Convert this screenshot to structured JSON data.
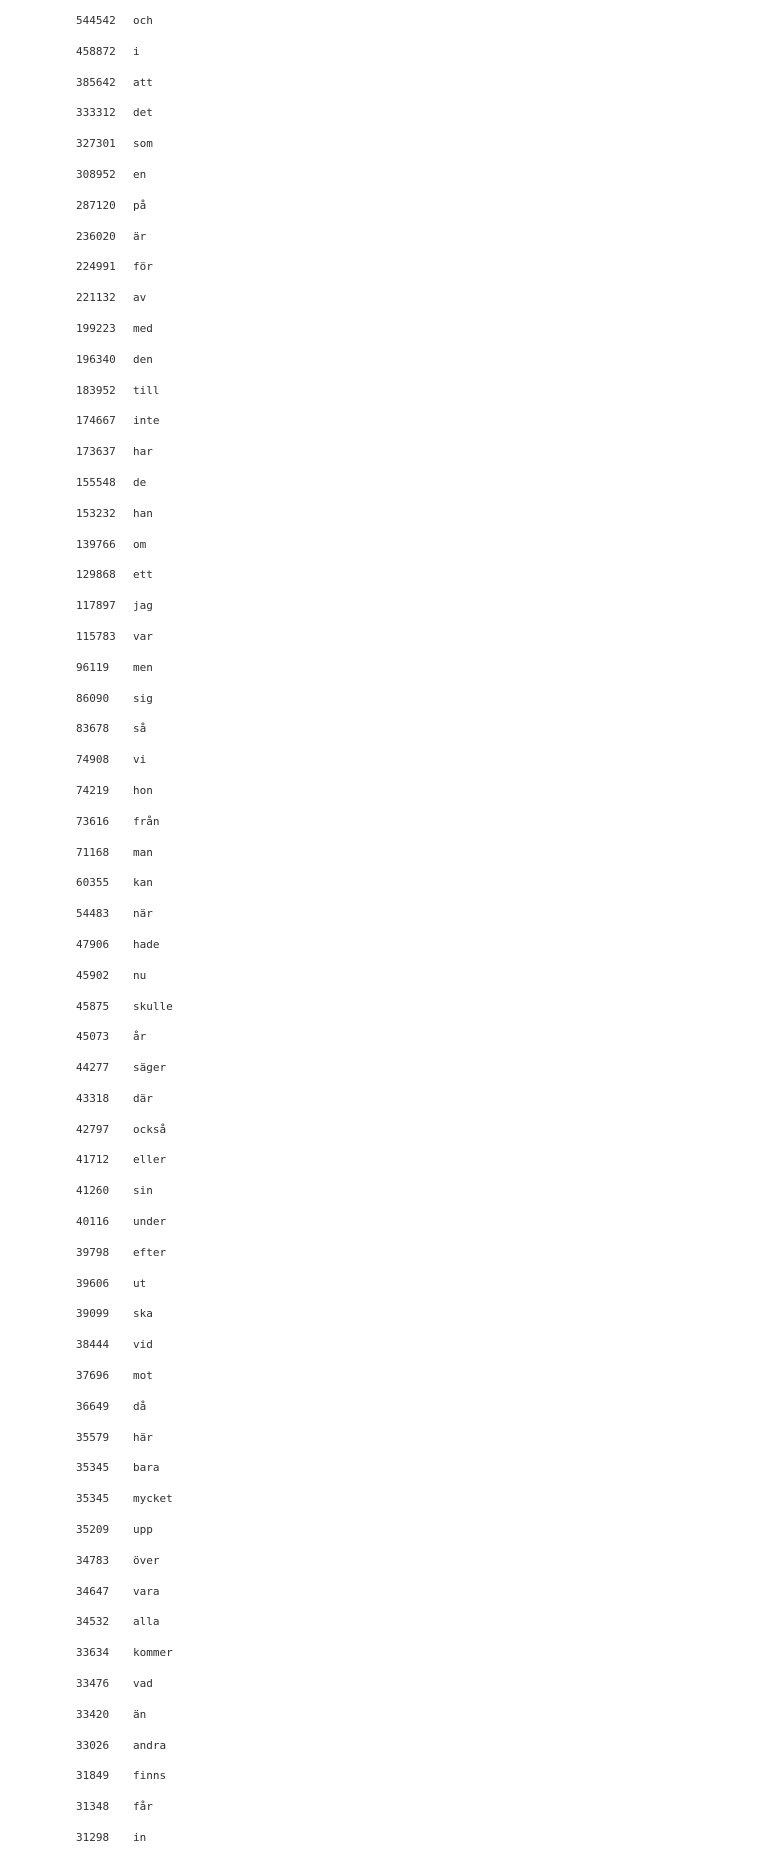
{
  "document": {
    "kind": "plain-text-word-frequency-listing",
    "language": "Swedish",
    "background_color": "#ffffff",
    "text_color": "#2f2f2f",
    "columns": [
      "count",
      "word"
    ],
    "row_count": 60,
    "rows": [
      {
        "count": "544542",
        "word": "och"
      },
      {
        "count": "458872",
        "word": "i"
      },
      {
        "count": "385642",
        "word": "att"
      },
      {
        "count": "333312",
        "word": "det"
      },
      {
        "count": "327301",
        "word": "som"
      },
      {
        "count": "308952",
        "word": "en"
      },
      {
        "count": "287120",
        "word": "på"
      },
      {
        "count": "236020",
        "word": "är"
      },
      {
        "count": "224991",
        "word": "för"
      },
      {
        "count": "221132",
        "word": "av"
      },
      {
        "count": "199223",
        "word": "med"
      },
      {
        "count": "196340",
        "word": "den"
      },
      {
        "count": "183952",
        "word": "till"
      },
      {
        "count": "174667",
        "word": "inte"
      },
      {
        "count": "173637",
        "word": "har"
      },
      {
        "count": "155548",
        "word": "de"
      },
      {
        "count": "153232",
        "word": "han"
      },
      {
        "count": "139766",
        "word": "om"
      },
      {
        "count": "129868",
        "word": "ett"
      },
      {
        "count": "117897",
        "word": "jag"
      },
      {
        "count": "115783",
        "word": "var"
      },
      {
        "count": "96119",
        "word": "men"
      },
      {
        "count": "86090",
        "word": "sig"
      },
      {
        "count": "83678",
        "word": "så"
      },
      {
        "count": "74908",
        "word": "vi"
      },
      {
        "count": "74219",
        "word": "hon"
      },
      {
        "count": "73616",
        "word": "från"
      },
      {
        "count": "71168",
        "word": "man"
      },
      {
        "count": "60355",
        "word": "kan"
      },
      {
        "count": "54483",
        "word": "när"
      },
      {
        "count": "47906",
        "word": "hade"
      },
      {
        "count": "45902",
        "word": "nu"
      },
      {
        "count": "45875",
        "word": "skulle"
      },
      {
        "count": "45073",
        "word": "år"
      },
      {
        "count": "44277",
        "word": "säger"
      },
      {
        "count": "43318",
        "word": "där"
      },
      {
        "count": "42797",
        "word": "också"
      },
      {
        "count": "41712",
        "word": "eller"
      },
      {
        "count": "41260",
        "word": "sin"
      },
      {
        "count": "40116",
        "word": "under"
      },
      {
        "count": "39798",
        "word": "efter"
      },
      {
        "count": "39606",
        "word": "ut"
      },
      {
        "count": "39099",
        "word": "ska"
      },
      {
        "count": "38444",
        "word": "vid"
      },
      {
        "count": "37696",
        "word": "mot"
      },
      {
        "count": "36649",
        "word": "då"
      },
      {
        "count": "35579",
        "word": "här"
      },
      {
        "count": "35345",
        "word": "bara"
      },
      {
        "count": "35345",
        "word": "mycket"
      },
      {
        "count": "35209",
        "word": "upp"
      },
      {
        "count": "34783",
        "word": "över"
      },
      {
        "count": "34647",
        "word": "vara"
      },
      {
        "count": "34532",
        "word": "alla"
      },
      {
        "count": "33634",
        "word": "kommer"
      },
      {
        "count": "33476",
        "word": "vad"
      },
      {
        "count": "33420",
        "word": "än"
      },
      {
        "count": "33026",
        "word": "andra"
      },
      {
        "count": "31849",
        "word": "finns"
      },
      {
        "count": "31348",
        "word": "får"
      },
      {
        "count": "31298",
        "word": "in"
      }
    ]
  }
}
